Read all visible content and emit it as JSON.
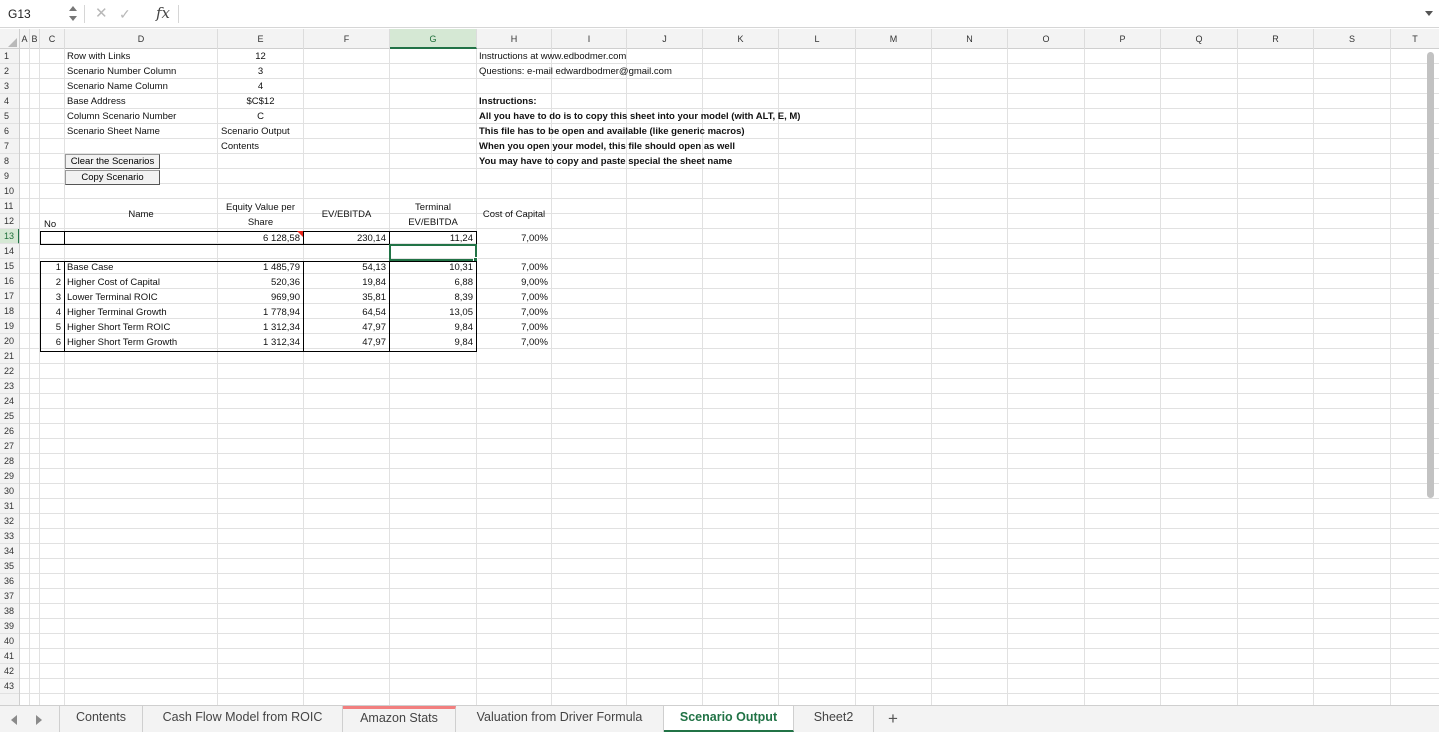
{
  "formula_bar": {
    "name_box": "G13",
    "formula": ""
  },
  "columns": [
    "A",
    "B",
    "C",
    "D",
    "E",
    "F",
    "G",
    "H",
    "I",
    "J",
    "K",
    "L",
    "M",
    "N",
    "O",
    "P",
    "Q",
    "R",
    "S",
    "T"
  ],
  "selected_column": "G",
  "rows": [
    "1",
    "2",
    "3",
    "4",
    "5",
    "6",
    "7",
    "8",
    "9",
    "10",
    "11",
    "12",
    "13",
    "14",
    "15",
    "16",
    "17",
    "18",
    "19",
    "20",
    "21",
    "22",
    "23",
    "24",
    "25",
    "26",
    "27",
    "28",
    "29",
    "30",
    "31",
    "32",
    "33",
    "34",
    "35",
    "36",
    "37",
    "38",
    "39",
    "40",
    "41",
    "42",
    "43"
  ],
  "selected_row": "13",
  "settings": {
    "labels": [
      "Row with Links",
      "Scenario Number Column",
      "Scenario Name Column",
      "Base Address",
      "Column Scenario Number",
      "Scenario Sheet Name"
    ],
    "values": [
      "12",
      "3",
      "4",
      "$C$12",
      "C",
      "Scenario Output"
    ],
    "extra_value": "Contents"
  },
  "instructions": {
    "line1": "Instructions at www.edbodmer.com",
    "line2": "Questions: e-mail edwardbodmer@gmail.com",
    "heading": "Instructions:",
    "items": [
      "All you have to do is to copy this sheet into your model (with ALT, E, M)",
      "This file has to be open and available (like generic macros)",
      "When you open your model, this file should open as well",
      "You may have to copy and paste special the sheet name"
    ]
  },
  "buttons": {
    "clear": "Clear the Scenarios",
    "copy": "Copy Scenario"
  },
  "table": {
    "headers": {
      "no": "No",
      "name": "Name",
      "equity_1": "Equity Value per",
      "equity_2": "Share",
      "ev": "EV/EBITDA",
      "terminal_1": "Terminal",
      "terminal_2": "EV/EBITDA",
      "coc": "Cost of Capital"
    },
    "current": {
      "equity": "6 128,58",
      "ev": "230,14",
      "terminal": "11,24",
      "coc": "7,00%"
    },
    "scenarios": [
      {
        "no": "1",
        "name": "Base Case",
        "equity": "1 485,79",
        "ev": "54,13",
        "terminal": "10,31",
        "coc": "7,00%"
      },
      {
        "no": "2",
        "name": "Higher Cost of Capital",
        "equity": "520,36",
        "ev": "19,84",
        "terminal": "6,88",
        "coc": "9,00%"
      },
      {
        "no": "3",
        "name": "Lower Terminal ROIC",
        "equity": "969,90",
        "ev": "35,81",
        "terminal": "8,39",
        "coc": "7,00%"
      },
      {
        "no": "4",
        "name": "Higher Terminal Growth",
        "equity": "1 778,94",
        "ev": "64,54",
        "terminal": "13,05",
        "coc": "7,00%"
      },
      {
        "no": "5",
        "name": "Higher Short Term ROIC",
        "equity": "1 312,34",
        "ev": "47,97",
        "terminal": "9,84",
        "coc": "7,00%"
      },
      {
        "no": "6",
        "name": "Higher Short Term Growth",
        "equity": "1 312,34",
        "ev": "47,97",
        "terminal": "9,84",
        "coc": "7,00%"
      }
    ]
  },
  "sheet_tabs": [
    {
      "label": "Contents"
    },
    {
      "label": "Cash Flow Model from ROIC"
    },
    {
      "label": "Amazon Stats"
    },
    {
      "label": "Valuation from Driver Formula"
    },
    {
      "label": "Scenario Output"
    },
    {
      "label": "Sheet2"
    }
  ],
  "active_tab": "Scenario Output",
  "add_sheet_label": "+",
  "colors": {
    "accent": "#217346",
    "tab_color": "#f27f7f",
    "comment_marker": "#e8251a"
  }
}
